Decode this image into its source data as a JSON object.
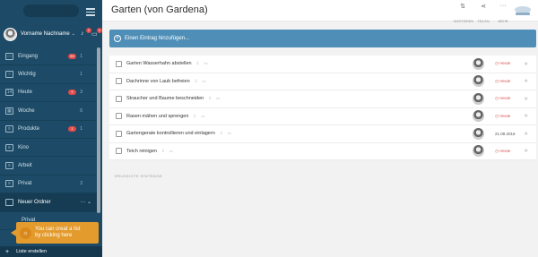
{
  "sidebar": {
    "user": {
      "name": "Vorname Nachname",
      "bell_count": "1",
      "chat_count": "1"
    },
    "items": [
      {
        "icon": "inbox-icon",
        "glyph": "▭",
        "label": "Eingang",
        "badge": "50",
        "count": "1"
      },
      {
        "icon": "star-icon",
        "glyph": "☆",
        "label": "Wichtig",
        "badge": "",
        "count": "1"
      },
      {
        "icon": "today-icon",
        "glyph": "14",
        "label": "Heute",
        "badge": "9",
        "count": "3"
      },
      {
        "icon": "week-icon",
        "glyph": "▦",
        "label": "Woche",
        "badge": "",
        "count": "6"
      },
      {
        "icon": "list-icon",
        "glyph": "≡",
        "label": "Produkte",
        "badge": "1",
        "count": "1"
      },
      {
        "icon": "list-icon",
        "glyph": "≡",
        "label": "Kino",
        "badge": "",
        "count": ""
      },
      {
        "icon": "list-icon",
        "glyph": "≡",
        "label": "Arbeit",
        "badge": "",
        "count": ""
      },
      {
        "icon": "list-icon",
        "glyph": "≡",
        "label": "Privat",
        "badge": "",
        "count": "2"
      }
    ],
    "folder": {
      "label": "Neuer Ordner",
      "actions": "··· ⌄"
    },
    "sub_item": "Privat",
    "tooltip": {
      "line1": "You can creat a list",
      "line2": "by clicking here",
      "icon": "lightbulb-icon"
    },
    "create_list": "Liste erstellen"
  },
  "main": {
    "title": "Garten (von Gardena)",
    "toolbar": {
      "sort": "SORTIEREN",
      "share": "TEILEN",
      "more": "MEHR"
    },
    "add_placeholder": "Einen Eintrag hinzufügen...",
    "tasks": [
      {
        "title": "Garten Wasserhahn abstellen",
        "due": "Heute"
      },
      {
        "title": "Dachrinne von Laub befreien",
        "due": "Heute"
      },
      {
        "title": "Straucher und Baume beschneiden",
        "due": "Heute"
      },
      {
        "title": "Rasen mähen und sprengen",
        "due": "Heute"
      },
      {
        "title": "Gartengerate kontrollieren und einlagern",
        "due": "21.08.2016"
      },
      {
        "title": "Teich reinigen",
        "due": "Heute"
      }
    ],
    "done_label": "ERLEDIGTE EINTRÄGE"
  },
  "colors": {
    "sidebar": "#1d4a66",
    "accent": "#4f8fb7",
    "tooltip": "#e39b2d",
    "due": "#d9534f"
  }
}
